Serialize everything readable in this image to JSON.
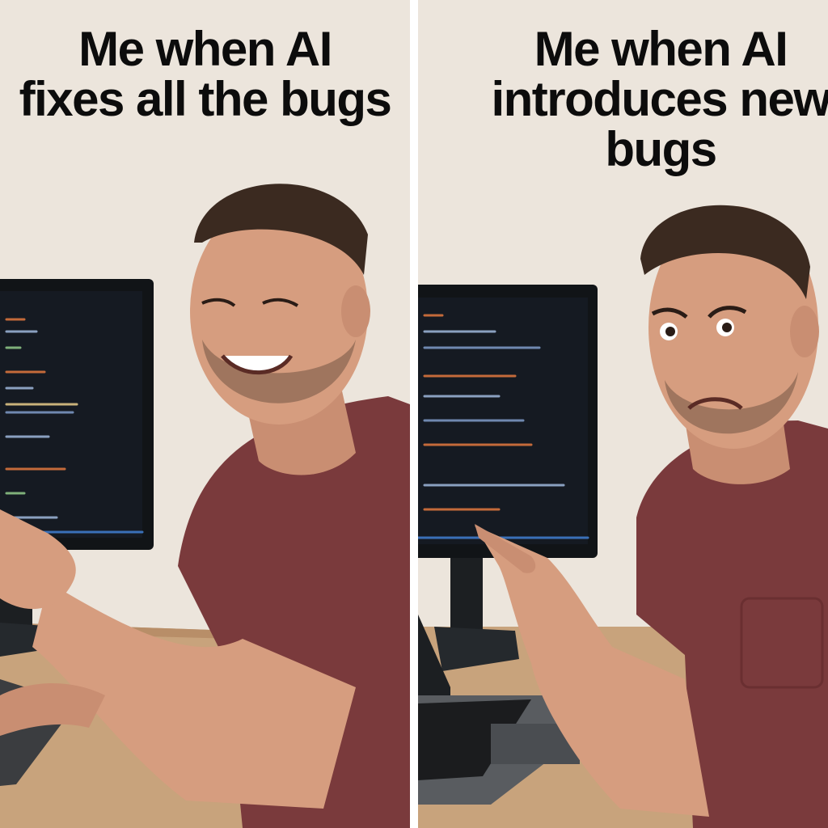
{
  "panels": {
    "left": {
      "caption_line1": "Me when AI",
      "caption_line2": "fixes all the bugs"
    },
    "right": {
      "caption_line1": "Me when AI",
      "caption_line2": "introduces new",
      "caption_line3": "bugs"
    }
  },
  "colors": {
    "wall": "#ece5dc",
    "desk": "#c8a37c",
    "shirt": "#7a3a3c",
    "skin": "#d69d7f",
    "hair": "#3b2a20",
    "monitor": "#111417",
    "caption_text": "#0c0c0c",
    "divider": "#ffffff"
  }
}
